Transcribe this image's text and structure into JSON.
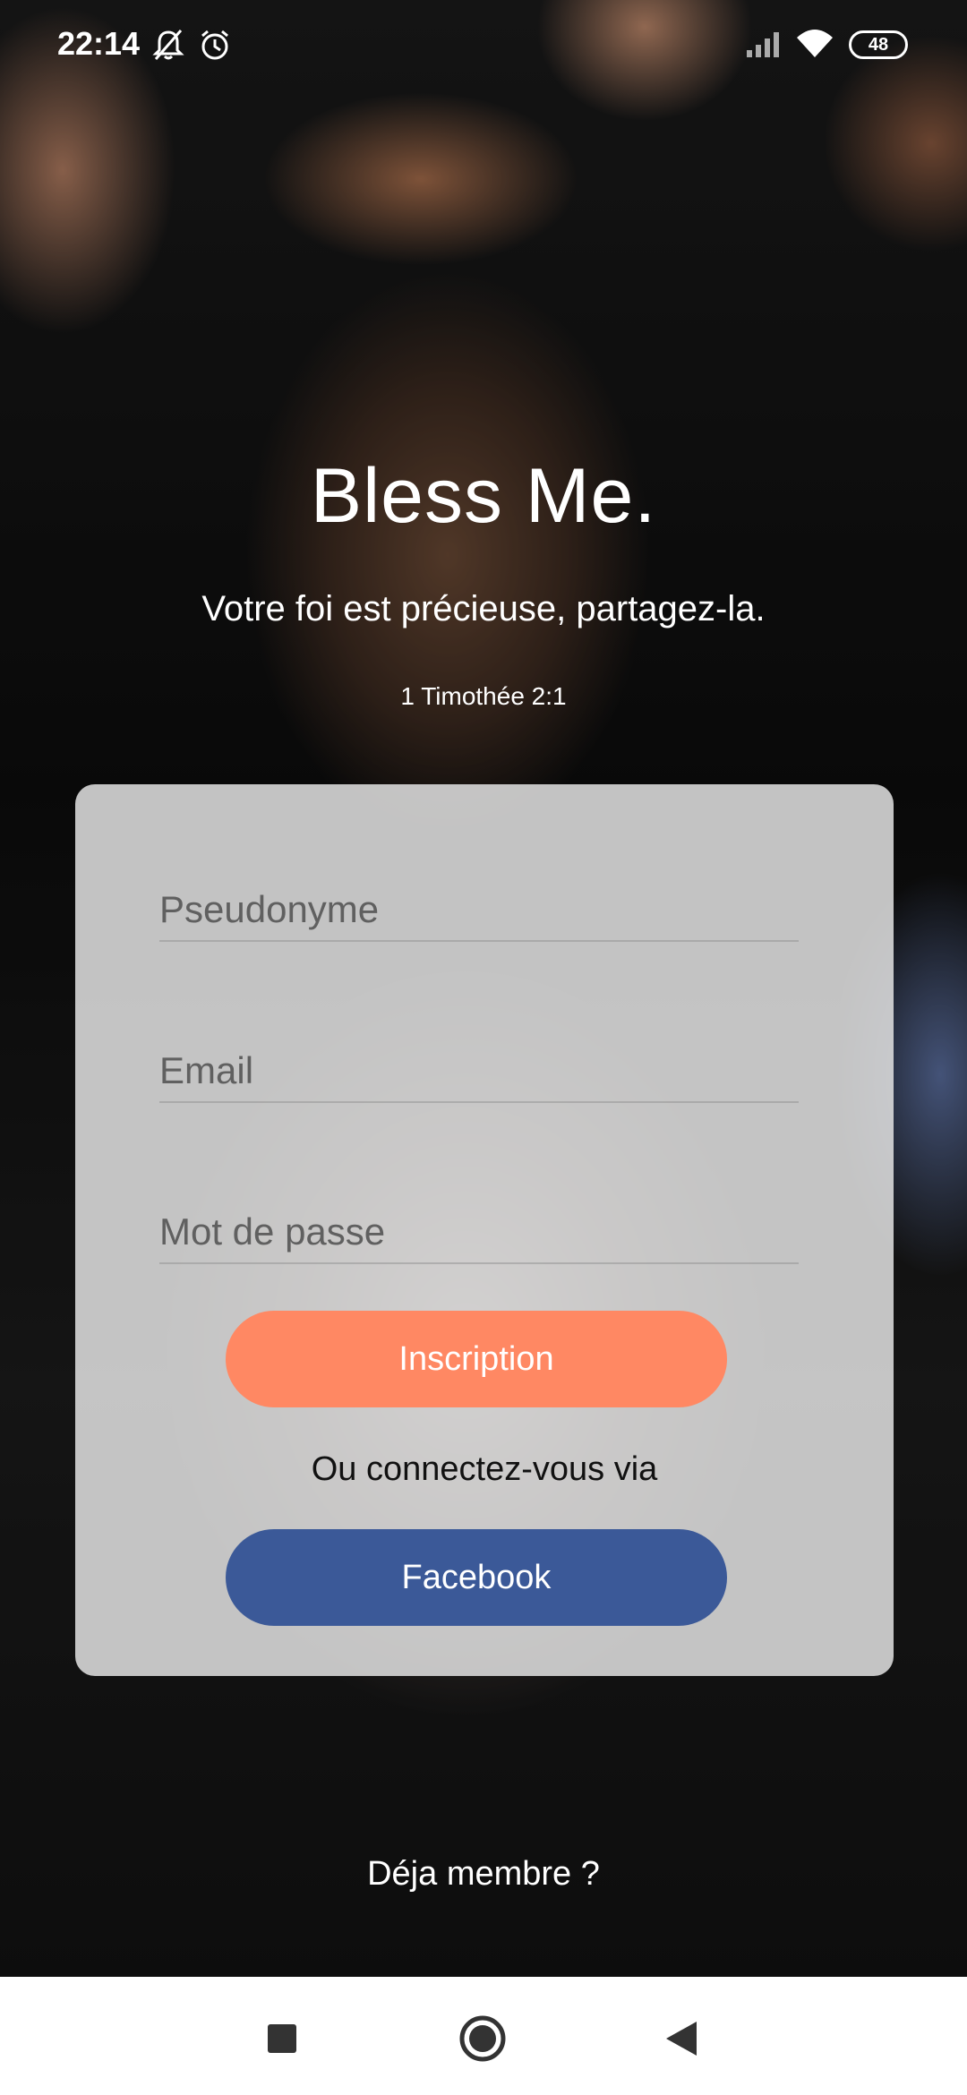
{
  "status_bar": {
    "time": "22:14",
    "battery": "48",
    "icons": [
      "bell-off-icon",
      "alarm-icon",
      "signal-icon",
      "wifi-icon",
      "battery-icon"
    ]
  },
  "header": {
    "title": "Bless Me.",
    "tagline": "Votre foi est précieuse, partagez-la.",
    "verse": "1 Timothée 2:1"
  },
  "form": {
    "username_placeholder": "Pseudonyme",
    "email_placeholder": "Email",
    "password_placeholder": "Mot de passe",
    "signup_label": "Inscription",
    "or_text": "Ou connectez-vous via",
    "facebook_label": "Facebook"
  },
  "footer": {
    "member_link": "Déja membre ?"
  },
  "navigation": {
    "buttons": [
      "recents-square-icon",
      "home-circle-icon",
      "back-triangle-icon"
    ]
  },
  "colors": {
    "signup_button": "#ff8863",
    "facebook_button": "#3b5998",
    "card_background": "#e2e2e2"
  }
}
